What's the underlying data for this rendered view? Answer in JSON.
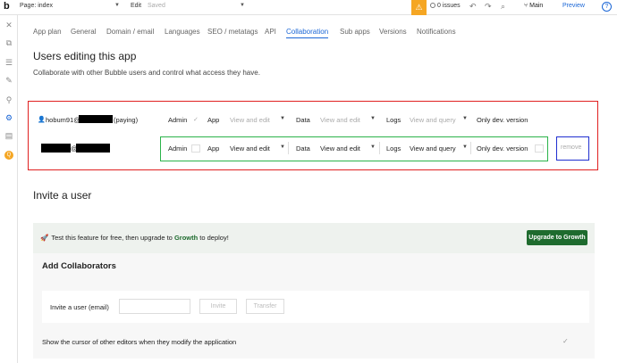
{
  "topbar": {
    "logo": "b",
    "page_select": "Page: index",
    "edit": "Edit",
    "saved": "Saved",
    "alert_icon": "alert-icon",
    "issues": "0 issues",
    "branch": "Main",
    "preview": "Preview",
    "help": "?"
  },
  "tabs": [
    "App plan",
    "General",
    "Domain / email",
    "Languages",
    "SEO / metatags",
    "API",
    "Collaboration",
    "Sub apps",
    "Versions",
    "Notifications"
  ],
  "heading": "Users editing this app",
  "subheading": "Collaborate with other Bubble users and control what access they have.",
  "collaborators": {
    "row1": {
      "email_prefix": "hobum91@",
      "plan": "(paying)",
      "admin_label": "Admin",
      "app_label": "App",
      "app_value": "View and edit",
      "data_label": "Data",
      "data_value": "View and edit",
      "logs_label": "Logs",
      "logs_value": "View and query",
      "version": "Only dev. version"
    },
    "row2": {
      "at": "@",
      "admin_label": "Admin",
      "app_label": "App",
      "app_value": "View and edit",
      "data_label": "Data",
      "data_value": "View and edit",
      "logs_label": "Logs",
      "logs_value": "View and query",
      "version": "Only dev. version",
      "remove": "remove"
    }
  },
  "invite": {
    "heading": "Invite a user",
    "banner_prefix": "Test this feature for free, then upgrade to ",
    "banner_plan": "Growth",
    "banner_suffix": " to deploy!",
    "upgrade_button": "Upgrade to Growth",
    "add_heading": "Add Collaborators",
    "invite_label": "Invite a user (email)",
    "invite_value": "",
    "invite_button": "Invite",
    "transfer_button": "Transfer",
    "cursor_option": "Show the cursor of other editors when they modify the application"
  },
  "colors": {
    "accent": "#1a66d6",
    "growth_green": "#1e6b2e",
    "alert_orange": "#f5a623",
    "annotation_red": "#e02020",
    "annotation_green": "#2bb34a",
    "annotation_blue": "#1f2fd0"
  }
}
